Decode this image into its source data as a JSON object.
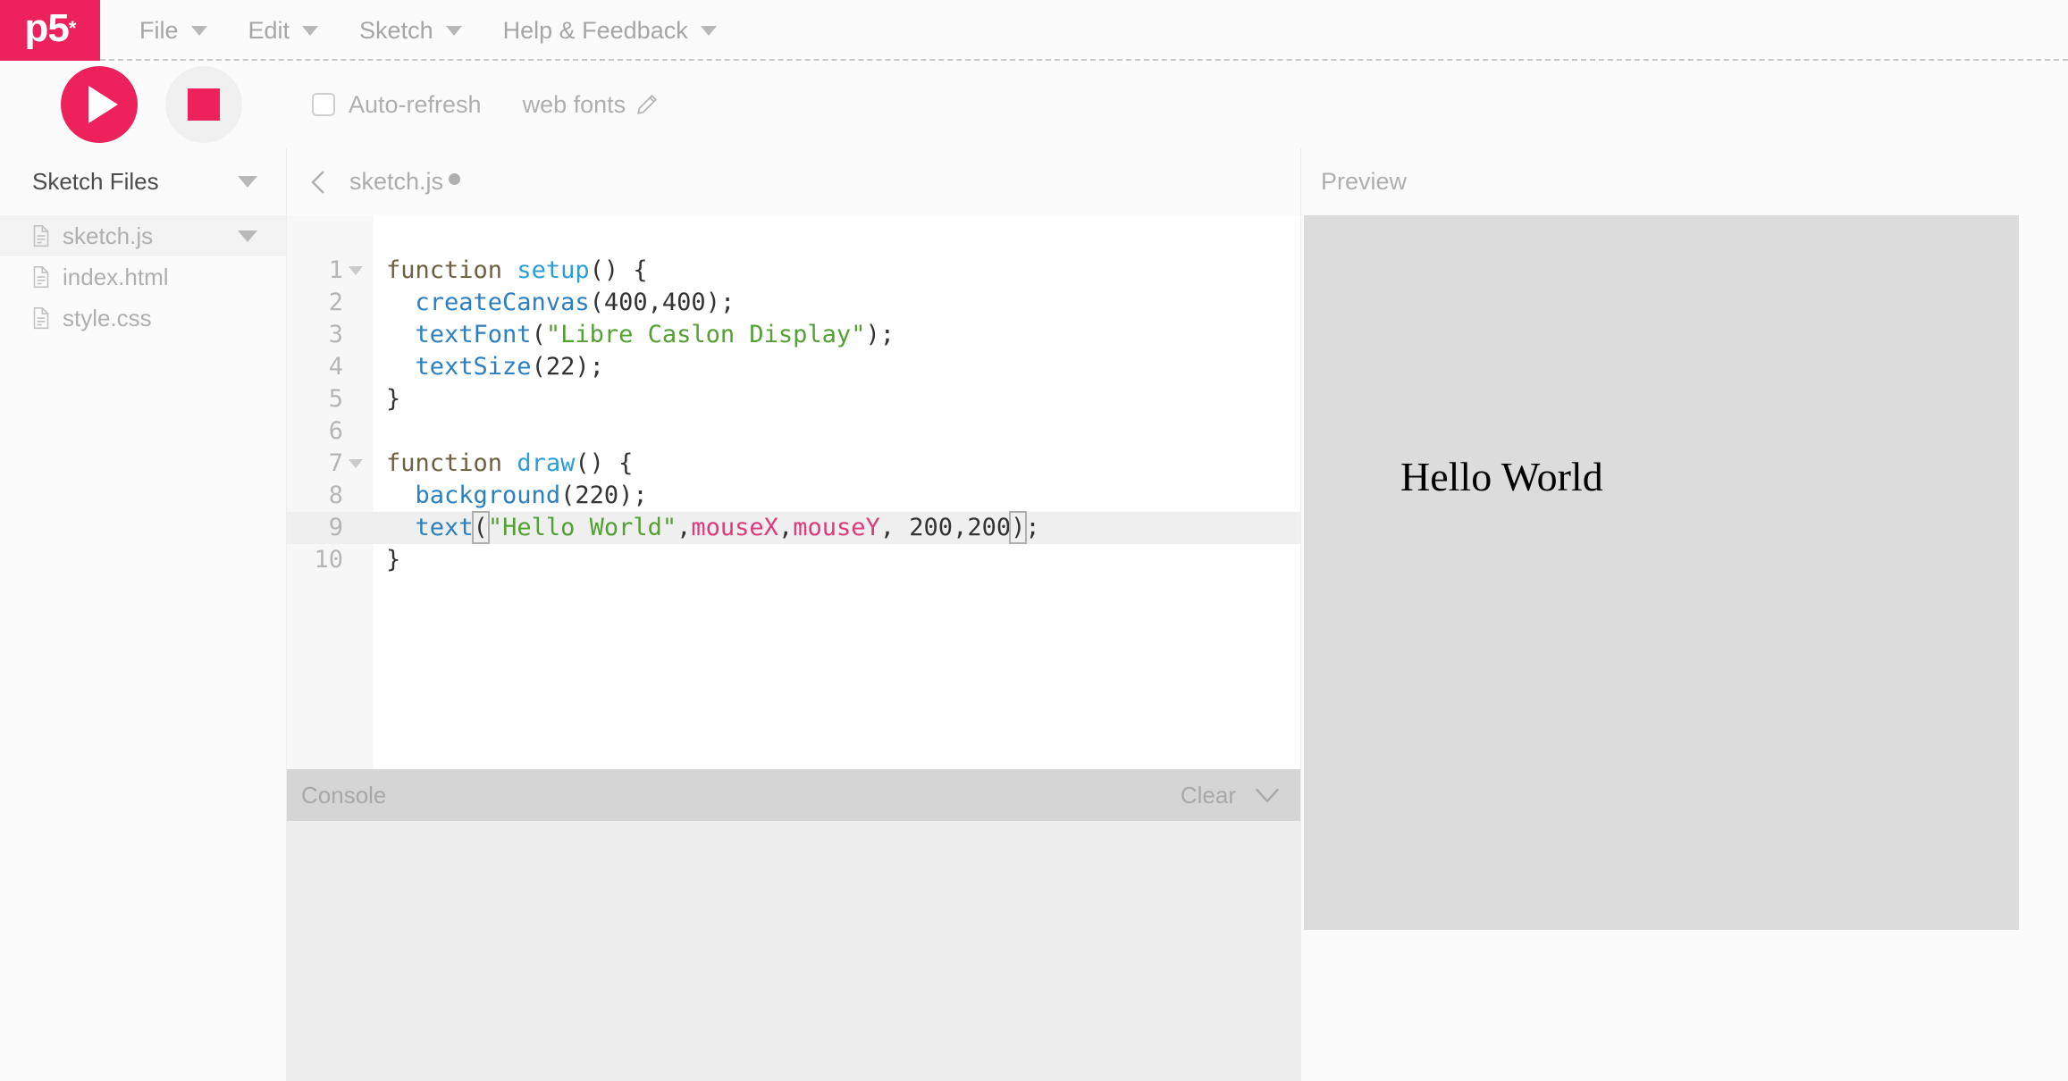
{
  "app": {
    "logo_text": "p5",
    "logo_superscript": "*",
    "accent_color": "#ED225D"
  },
  "nav": {
    "items": [
      {
        "label": "File",
        "icon": "chevron-down-icon"
      },
      {
        "label": "Edit",
        "icon": "chevron-down-icon"
      },
      {
        "label": "Sketch",
        "icon": "chevron-down-icon"
      },
      {
        "label": "Help & Feedback",
        "icon": "chevron-down-icon"
      }
    ]
  },
  "toolbar": {
    "play_icon": "play-icon",
    "stop_icon": "stop-icon",
    "auto_refresh_label": "Auto-refresh",
    "auto_refresh_checked": false,
    "web_fonts_label": "web fonts",
    "web_fonts_icon": "pencil-icon"
  },
  "sidebar": {
    "title": "Sketch Files",
    "collapse_icon": "chevron-down-icon",
    "files": [
      {
        "name": "sketch.js",
        "icon": "file-icon",
        "active": true,
        "has_menu": true
      },
      {
        "name": "index.html",
        "icon": "file-icon",
        "active": false,
        "has_menu": false
      },
      {
        "name": "style.css",
        "icon": "file-icon",
        "active": false,
        "has_menu": false
      }
    ]
  },
  "editor": {
    "back_icon": "chevron-left-icon",
    "tab_name": "sketch.js",
    "unsaved_indicator": "unsaved-dot",
    "active_line": 9,
    "fold_lines": [
      1,
      7
    ],
    "line_numbers": [
      "1",
      "2",
      "3",
      "4",
      "5",
      "6",
      "7",
      "8",
      "9",
      "10"
    ],
    "lines": [
      {
        "num": "1",
        "text": "function setup() {"
      },
      {
        "num": "2",
        "text": "  createCanvas(400,400);"
      },
      {
        "num": "3",
        "text": "  textFont(\"Libre Caslon Display\");"
      },
      {
        "num": "4",
        "text": "  textSize(22);"
      },
      {
        "num": "5",
        "text": "}"
      },
      {
        "num": "6",
        "text": ""
      },
      {
        "num": "7",
        "text": "function draw() {"
      },
      {
        "num": "8",
        "text": "  background(220);"
      },
      {
        "num": "9",
        "text": "  text(\"Hello World\",mouseX,mouseY, 200,200);"
      },
      {
        "num": "10",
        "text": "}"
      }
    ],
    "syntax_colors": {
      "keyword": "#6E6040",
      "function_name": "#2D9CD7",
      "builtin": "#2C7FC1",
      "string": "#54A035",
      "variable": "#DD3A7B",
      "plain": "#333333"
    }
  },
  "console": {
    "title": "Console",
    "clear_label": "Clear",
    "collapse_icon": "chevron-down-icon",
    "messages": []
  },
  "preview": {
    "label": "Preview",
    "canvas_text": "Hello World",
    "canvas_background": "#DCDCDC",
    "canvas_width": "400",
    "canvas_height": "400",
    "text_font": "Libre Caslon Display",
    "text_size": "22"
  }
}
